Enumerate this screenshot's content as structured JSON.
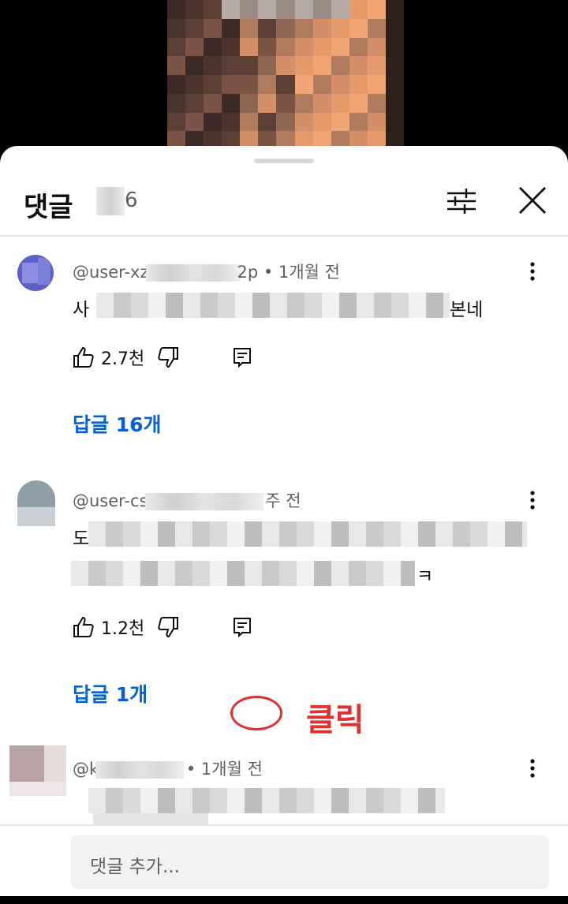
{
  "header": {
    "title": "댓글",
    "count_suffix": "6"
  },
  "icons": {
    "filter": "sliders-icon",
    "close": "close-icon",
    "more": "more-vert-icon",
    "like": "thumb-up-icon",
    "dislike": "thumb-down-icon",
    "reply": "reply-comment-icon"
  },
  "comments": [
    {
      "author_prefix": "@user-xz",
      "author_suffix": "2p",
      "time": "• 1개월 전",
      "body_start": "사",
      "body_end": "본네",
      "likes": "2.7천",
      "replies_label": "답글 16개"
    },
    {
      "author_prefix": "@user-cs",
      "author_suffix": "",
      "time": "주 전",
      "body_start": "도",
      "body_end": "",
      "body2_start": "",
      "body2_end": "ㅋ",
      "likes": "1.2천",
      "replies_label": "답글 1개"
    },
    {
      "author_prefix": "@k",
      "author_suffix": "",
      "time": "• 1개월 전",
      "body_start": "",
      "body_end": ""
    }
  ],
  "composer": {
    "placeholder": "댓글 추가..."
  },
  "annotation": {
    "label": "클릭",
    "color": "#e03131"
  },
  "colors": {
    "link": "#065fd4",
    "text_primary": "#0f0f0f",
    "text_secondary": "#606060"
  }
}
